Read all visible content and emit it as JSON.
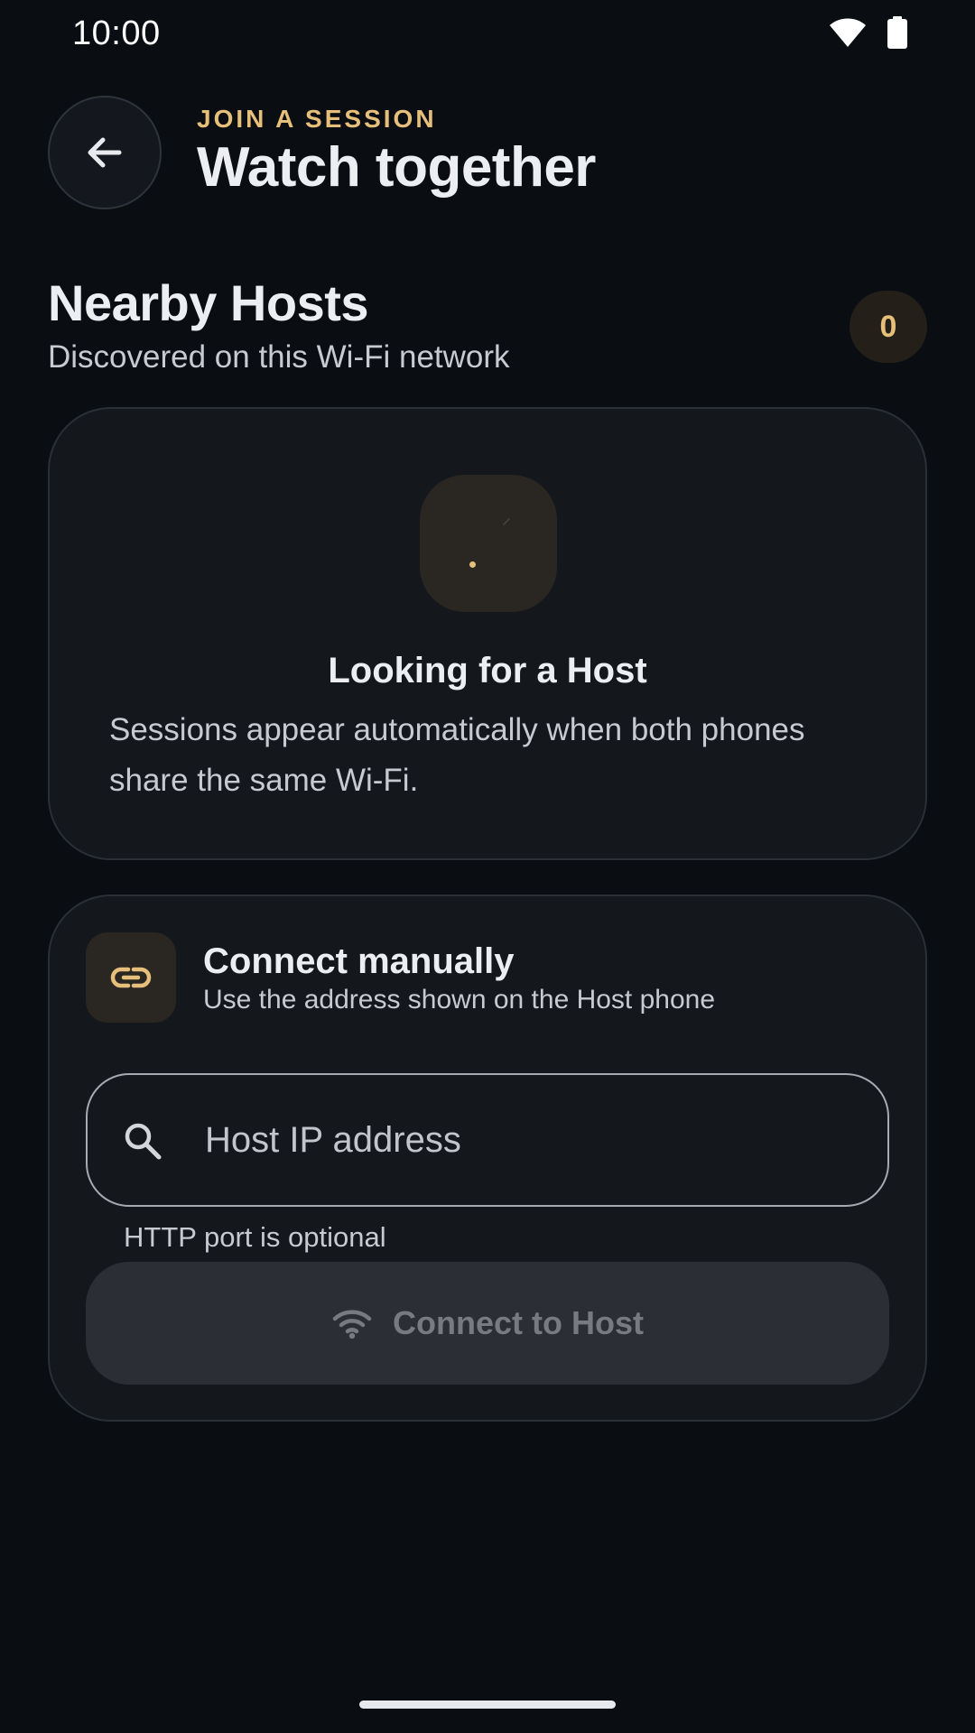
{
  "status_bar": {
    "time": "10:00",
    "icons": [
      "wifi-icon",
      "battery-icon"
    ]
  },
  "header": {
    "back_icon": "arrow-left-icon",
    "eyebrow": "JOIN A SESSION",
    "title": "Watch together"
  },
  "nearby": {
    "title": "Nearby Hosts",
    "subtitle": "Discovered on this Wi-Fi network",
    "count": "0",
    "empty_state": {
      "icon": "radar-scan-icon",
      "title": "Looking for a Host",
      "description": "Sessions appear automatically when both phones share the same Wi-Fi."
    }
  },
  "manual": {
    "icon": "link-icon",
    "title": "Connect manually",
    "description": "Use the address shown on the Host phone",
    "field": {
      "icon": "search-icon",
      "placeholder": "Host IP address",
      "value": "",
      "helper": "HTTP port is optional"
    },
    "button": {
      "icon": "wifi-icon",
      "label": "Connect to Host",
      "enabled": false
    }
  },
  "colors": {
    "background": "#0a0d12",
    "card": "#14171c",
    "accent": "#e6c07a",
    "text_primary": "#eceef2",
    "text_secondary": "#c8cad1",
    "button_disabled_bg": "#2b2e34",
    "button_disabled_text": "#777a80"
  }
}
